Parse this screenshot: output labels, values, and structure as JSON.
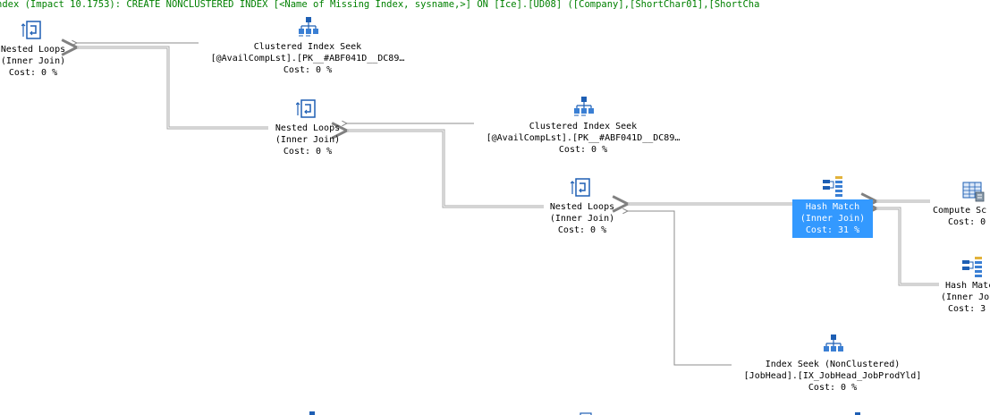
{
  "missing_index_text": "ndex (Impact 10.1753): CREATE NONCLUSTERED INDEX [<Name of Missing Index, sysname,>] ON [Ice].[UD08] ([Company],[ShortChar01],[ShortCha",
  "nodes": {
    "nl_top": {
      "name": "Nested Loops",
      "sub": "(Inner Join)",
      "cost": "Cost: 0 %",
      "icon": "nested-loops-icon"
    },
    "cis_1": {
      "name": "Clustered Index Seek",
      "sub": "[@AvailCompLst].[PK__#ABF041D__DC89…",
      "cost": "Cost: 0 %",
      "icon": "clustered-index-seek-icon"
    },
    "nl_mid": {
      "name": "Nested Loops",
      "sub": "(Inner Join)",
      "cost": "Cost: 0 %",
      "icon": "nested-loops-icon"
    },
    "cis_2": {
      "name": "Clustered Index Seek",
      "sub": "[@AvailCompLst].[PK__#ABF041D__DC89…",
      "cost": "Cost: 0 %",
      "icon": "clustered-index-seek-icon"
    },
    "nl_low": {
      "name": "Nested Loops",
      "sub": "(Inner Join)",
      "cost": "Cost: 0 %",
      "icon": "nested-loops-icon"
    },
    "hm_1": {
      "name": "Hash Match",
      "sub": "(Inner Join)",
      "cost": "Cost: 31 %",
      "icon": "hash-match-icon"
    },
    "cs_1": {
      "name": "Compute Sc",
      "cost": "Cost: 0",
      "icon": "compute-scalar-icon"
    },
    "hm_2": {
      "name": "Hash Matc",
      "sub": "(Inner Jo",
      "cost": "Cost: 3",
      "icon": "hash-match-icon"
    },
    "is_1": {
      "name": "Index Seek (NonClustered)",
      "sub": "[JobHead].[IX_JobHead_JobProdYld]",
      "cost": "Cost: 0 %",
      "icon": "index-seek-icon"
    }
  },
  "colors": {
    "missing_index": "#008000",
    "selection": "#3399ff",
    "arrow": "#808080",
    "icon_blue": "#1e5fb4"
  }
}
